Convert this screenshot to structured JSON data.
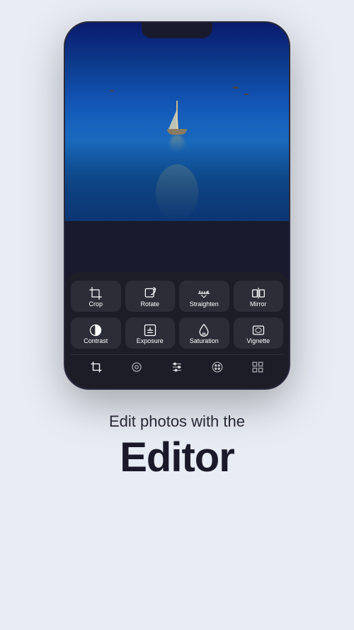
{
  "phone": {
    "tools_row1": [
      {
        "id": "crop",
        "label": "Crop"
      },
      {
        "id": "rotate",
        "label": "Rotate"
      },
      {
        "id": "straighten",
        "label": "Straighten"
      },
      {
        "id": "mirror",
        "label": "Mirror"
      }
    ],
    "tools_row2": [
      {
        "id": "contrast",
        "label": "Contrast"
      },
      {
        "id": "exposure",
        "label": "Exposure"
      },
      {
        "id": "saturation",
        "label": "Saturation"
      },
      {
        "id": "vignette",
        "label": "Vignette"
      }
    ],
    "toolbar_icons": [
      "crop-tb",
      "lock-tb",
      "adjust-tb",
      "palette-tb",
      "grid-tb"
    ]
  },
  "page": {
    "subtitle": "Edit photos with the",
    "title": "Editor"
  }
}
